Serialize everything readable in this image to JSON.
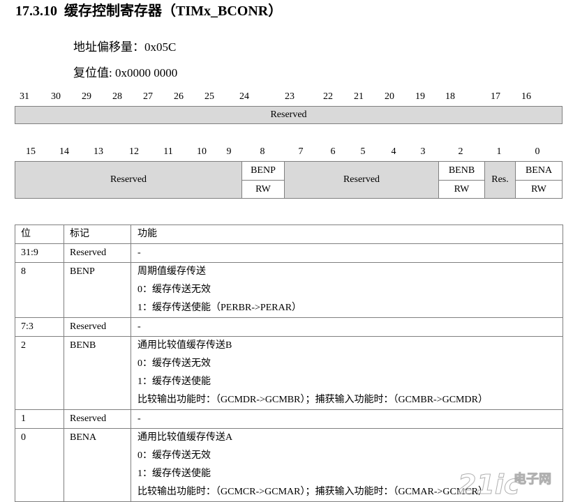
{
  "section": {
    "number": "17.3.10",
    "title": "缓存控制寄存器（TIMx_BCONR）"
  },
  "address_offset": "地址偏移量：0x05C",
  "reset_value": "复位值: 0x0000 0000",
  "register": {
    "upper_bits": [
      "31",
      "30",
      "29",
      "28",
      "27",
      "26",
      "25",
      "24",
      "23",
      "22",
      "21",
      "20",
      "19",
      "18",
      "17",
      "16"
    ],
    "upper_fields": [
      {
        "name": "Reserved",
        "reserved": true
      }
    ],
    "lower_bits": [
      "15",
      "14",
      "13",
      "12",
      "11",
      "10",
      "9",
      "8",
      "7",
      "6",
      "5",
      "4",
      "3",
      "2",
      "1",
      "0"
    ],
    "lower_fields": [
      {
        "name": "Reserved",
        "reserved": true
      },
      {
        "name": "BENP",
        "access": "RW"
      },
      {
        "name": "Reserved",
        "reserved": true
      },
      {
        "name": "BENB",
        "access": "RW"
      },
      {
        "name": "Res.",
        "reserved": true
      },
      {
        "name": "BENA",
        "access": "RW"
      }
    ]
  },
  "description_table": {
    "headers": [
      "位",
      "标记",
      "功能"
    ],
    "rows": [
      {
        "bit": "31:9",
        "field": "Reserved",
        "function": [
          "-"
        ]
      },
      {
        "bit": "8",
        "field": "BENP",
        "function": [
          "周期值缓存传送",
          "0：缓存传送无效",
          "1：缓存传送使能（PERBR->PERAR）"
        ]
      },
      {
        "bit": "7:3",
        "field": "Reserved",
        "function": [
          "-"
        ]
      },
      {
        "bit": "2",
        "field": "BENB",
        "function": [
          "通用比较值缓存传送B",
          "0：缓存传送无效",
          "1：缓存传送使能",
          "比较输出功能时：（GCMDR->GCMBR）；捕获输入功能时：（GCMBR->GCMDR）"
        ]
      },
      {
        "bit": "1",
        "field": "Reserved",
        "function": [
          "-"
        ]
      },
      {
        "bit": "0",
        "field": "BENA",
        "function": [
          "通用比较值缓存传送A",
          "0：缓存传送无效",
          "1：缓存传送使能",
          "比较输出功能时：（GCMCR->GCMAR）；捕获输入功能时：（GCMAR->GCMCR）"
        ]
      }
    ]
  },
  "colors": {
    "reserved_fill": "#d9d9d9",
    "border": "#7f7f7f",
    "text": "#000000"
  },
  "watermark": {
    "logo": "21ic",
    "label": "电子网"
  }
}
